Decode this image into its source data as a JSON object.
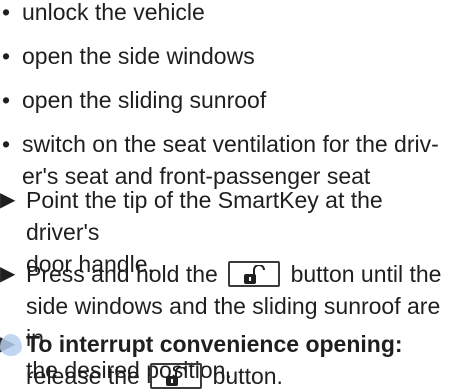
{
  "bullets": [
    "unlock the vehicle",
    "open the side windows",
    "open the sliding sunroof",
    "switch on the seat ventilation for the driv-",
    "er's seat and front-passenger seat"
  ],
  "steps": {
    "step1_line1": "Point the tip of the SmartKey at the driver's",
    "step1_line2": "door handle.",
    "step2_line1_pre": "Press and hold the",
    "step2_line1_post": "button until the",
    "step2_line2": "side windows and the sliding sunroof are in",
    "step2_line3": "the desired position.",
    "step3_bold": "To interrupt convenience opening:",
    "step3_line2_pre": "release the",
    "step3_line2_post": "button."
  },
  "glyphs": {
    "bullet": "•",
    "step_marker": "▶"
  },
  "icons": {
    "key_button": "unlock-key-icon"
  },
  "colors": {
    "text": "#1f1f1f",
    "icon_border": "#3a3a3a",
    "highlight": "#b8cfef"
  }
}
